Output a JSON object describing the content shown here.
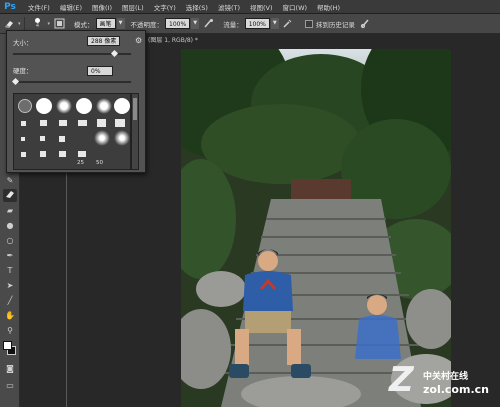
{
  "app": {
    "logo": "Ps"
  },
  "menu": {
    "items": [
      "文件(F)",
      "编辑(E)",
      "图像(I)",
      "图层(L)",
      "文字(Y)",
      "选择(S)",
      "滤镜(T)",
      "视图(V)",
      "窗口(W)",
      "帮助(H)"
    ]
  },
  "options": {
    "brush_size": "4",
    "mode_label": "模式：",
    "mode_value": "画笔",
    "opacity_label": "不透明度：",
    "opacity_value": "100%",
    "flow_label": "流量：",
    "flow_value": "100%",
    "history_label": "抹到历史记录"
  },
  "document": {
    "tab_title": "(图层 1, RGB/8) *"
  },
  "brush_panel": {
    "size_label": "大小：",
    "size_value": "288 像素",
    "hardness_label": "硬度：",
    "hardness_value": "0%",
    "size_level": 0.86,
    "hardness_level": 0.0,
    "preset_numbers": [
      "25",
      "50"
    ]
  },
  "toolbar": {
    "tools": [
      "move-icon",
      "marquee-icon",
      "lasso-icon",
      "quick-select-icon",
      "crop-icon",
      "eyedropper-icon",
      "healing-icon",
      "brush-icon",
      "stamp-icon",
      "history-brush-icon",
      "eraser-icon",
      "gradient-icon",
      "blur-icon",
      "dodge-icon",
      "pen-icon",
      "type-icon",
      "path-select-icon",
      "shape-icon",
      "hand-icon",
      "zoom-icon"
    ]
  },
  "watermark": {
    "brand_cn": "中关村在线",
    "url": "zol.com.cn"
  },
  "colors": {
    "accent": "#2fa3f5",
    "panel": "#535353",
    "toolbar": "#4a4a4a"
  }
}
